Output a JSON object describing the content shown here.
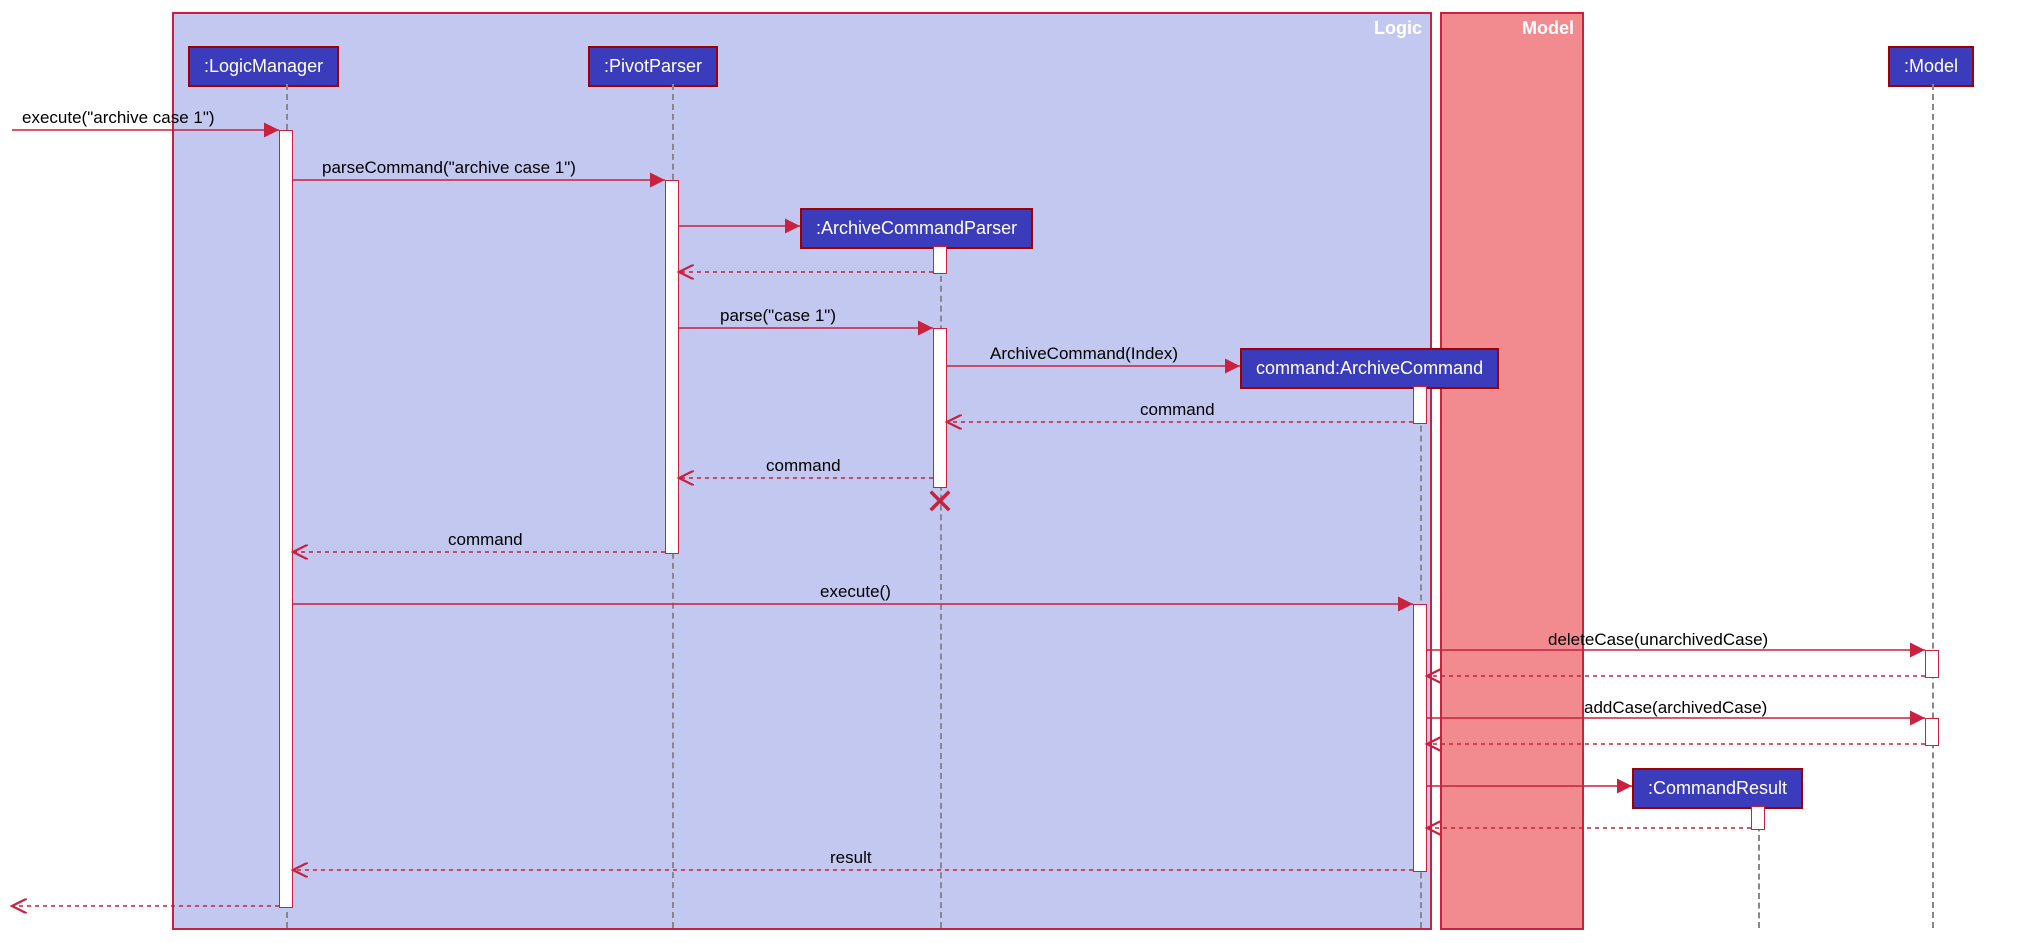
{
  "containers": {
    "logic": "Logic",
    "model": "Model"
  },
  "participants": {
    "logicManager": ":LogicManager",
    "pivotParser": ":PivotParser",
    "archiveCommandParser": ":ArchiveCommandParser",
    "archiveCommand": "command:ArchiveCommand",
    "commandResult": ":CommandResult",
    "model": ":Model"
  },
  "messages": {
    "execute1": "execute(\"archive case 1\")",
    "parseCommand": "parseCommand(\"archive case 1\")",
    "parse": "parse(\"case 1\")",
    "archiveCommandCtor": "ArchiveCommand(Index)",
    "returnCommand1": "command",
    "returnCommand2": "command",
    "returnCommand3": "command",
    "execute2": "execute()",
    "deleteCase": "deleteCase(unarchivedCase)",
    "addCase": "addCase(archivedCase)",
    "result": "result"
  }
}
